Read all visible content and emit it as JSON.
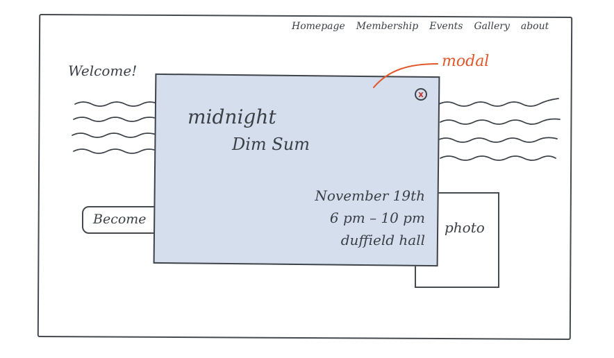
{
  "nav": {
    "items": [
      {
        "label": "Homepage"
      },
      {
        "label": "Membership"
      },
      {
        "label": "Events"
      },
      {
        "label": "Gallery"
      },
      {
        "label": "about"
      }
    ]
  },
  "main": {
    "welcome": "Welcome!",
    "become_button": "Become",
    "photo_label": "photo"
  },
  "modal": {
    "title_line1": "midnight",
    "title_line2": "Dim Sum",
    "date": "November 19th",
    "time": "6 pm – 10 pm",
    "location": "duffield hall",
    "close_glyph": "x"
  },
  "annotation": {
    "label": "modal",
    "color": "#e2572a"
  },
  "colors": {
    "ink": "#3b4047",
    "modal_fill": "#d4deec",
    "close_x": "#c0392b"
  }
}
